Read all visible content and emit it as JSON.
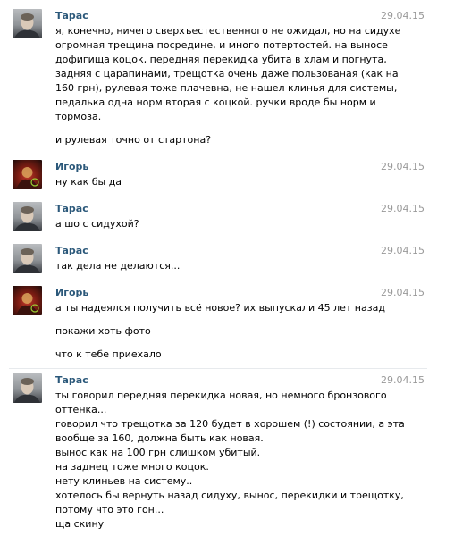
{
  "messages": [
    {
      "author": "Тарас",
      "avatar": "taras",
      "date": "29.04.15",
      "blocks": [
        [
          "я, конечно, ничего сверхъестественного не ожидал, но на сидухе",
          "огромная трещина посредине, и много потертостей. на выносе",
          "дофигища коцок, передняя перекидка убита в хлам и погнута,",
          "задняя с царапинами, трещотка очень даже пользованая (как на",
          "160 грн), рулевая тоже плачевна, не нашел клинья для системы,",
          "педалька одна норм вторая с коцкой. ручки вроде бы норм и",
          "тормоза."
        ],
        [
          "и рулевая точно от стартона?"
        ]
      ]
    },
    {
      "author": "Игорь",
      "avatar": "igor",
      "date": "29.04.15",
      "blocks": [
        [
          "ну как бы да"
        ]
      ]
    },
    {
      "author": "Тарас",
      "avatar": "taras",
      "date": "29.04.15",
      "blocks": [
        [
          "а шо с сидухой?"
        ]
      ]
    },
    {
      "author": "Тарас",
      "avatar": "taras",
      "date": "29.04.15",
      "blocks": [
        [
          "так дела не делаются..."
        ]
      ]
    },
    {
      "author": "Игорь",
      "avatar": "igor",
      "date": "29.04.15",
      "blocks": [
        [
          "а ты надеялся получить всё новое? их выпускали 45 лет назад"
        ],
        [
          "покажи хоть фото"
        ],
        [
          "что к тебе приехало"
        ]
      ]
    },
    {
      "author": "Тарас",
      "avatar": "taras",
      "date": "29.04.15",
      "blocks": [
        [
          "ты говорил передняя перекидка новая, но немного бронзового",
          "оттенка...",
          "говорил что трещотка за 120 будет в хорошем (!) состоянии, а эта",
          "вообще за 160, должна быть как новая.",
          "вынос как на 100 грн слишком убитый.",
          "на заднец тоже много коцок.",
          "нету клиньев на систему..",
          "хотелось бы вернуть назад сидуху, вынос, перекидки и трещотку,",
          "потому что это гон...",
          "ща скину"
        ]
      ]
    }
  ]
}
